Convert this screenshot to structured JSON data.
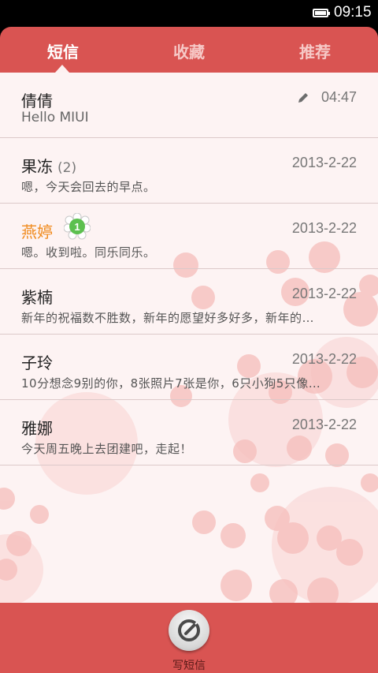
{
  "statusbar": {
    "time": "09:15",
    "battery_icon": "battery-full-icon"
  },
  "tabs": [
    {
      "label": "短信",
      "active": true
    },
    {
      "label": "收藏",
      "active": false
    },
    {
      "label": "推荐",
      "active": false
    }
  ],
  "conversations": [
    {
      "name": "倩倩",
      "time": "04:47",
      "preview": "Hello MIUI",
      "draft_icon": "pencil-icon"
    },
    {
      "name": "果冻",
      "count": "(2)",
      "time": "2013-2-22",
      "preview": "嗯，今天会回去的早点。"
    },
    {
      "name": "燕婷",
      "unread_badge": "1",
      "time": "2013-2-22",
      "preview": "嗯。收到啦。同乐同乐。"
    },
    {
      "name": "紫楠",
      "time": "2013-2-22",
      "preview": "新年的祝福数不胜数，新年的愿望好多好多，新年的…"
    },
    {
      "name": "子玲",
      "time": "2013-2-22",
      "preview": "10分想念9别的你，8张照片7张是你，6只小狗5只像…"
    },
    {
      "name": "雅娜",
      "time": "2013-2-22",
      "preview": "今天周五晚上去团建吧，走起！"
    }
  ],
  "compose": {
    "label": "写短信",
    "icon": "compose-icon"
  },
  "colors": {
    "accent": "#d95452",
    "sheet": "#fdf3f3",
    "unread_name": "#f08a1c",
    "badge": "#5cc04f"
  }
}
